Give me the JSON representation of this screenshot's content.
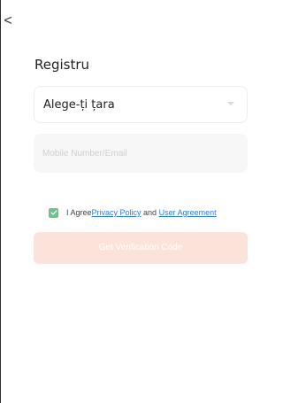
{
  "header": {
    "back_icon": "chevron-left-icon",
    "back_glyph": "<"
  },
  "title": "Registru",
  "country_select": {
    "value": "Alege-ți țara",
    "icon": "chevron-down-icon"
  },
  "account_input": {
    "placeholder": "Mobile Number/Email",
    "value": ""
  },
  "agreement": {
    "checked": true,
    "prefix": "I Agree",
    "privacy_link": "Privacy Policy",
    "joiner": " and ",
    "user_agreement_link": "User Agreement"
  },
  "verify_button": {
    "label": "Get Verification Code"
  },
  "colors": {
    "accent": "#6cc48a",
    "link": "#2f7be5",
    "button_disabled": "#fbe3d9"
  }
}
